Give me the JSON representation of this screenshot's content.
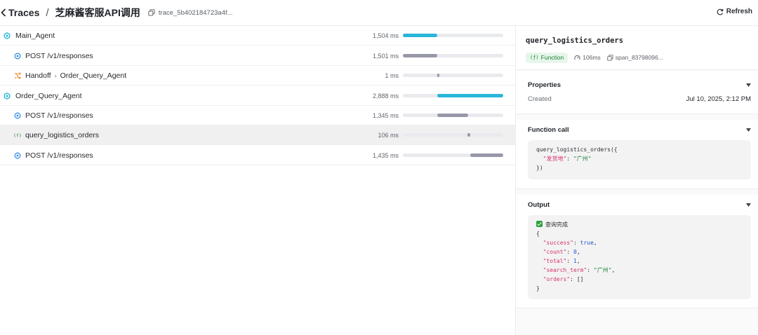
{
  "header": {
    "breadcrumb_root": "Traces",
    "separator": "/",
    "trace_title": "芝麻酱客服API调用",
    "trace_id": "trace_5b402184723a4f...",
    "refresh_label": "Refresh"
  },
  "colors": {
    "agent_bar": "#29b6d9",
    "span_bar": "#9698a8",
    "function_green": "#1a7f37",
    "handoff_orange": "#f08c2c"
  },
  "tree": {
    "rows": [
      {
        "label": "Main_Agent",
        "duration": "1,504 ms",
        "icon": "agent-icon",
        "bar_start": 0.0,
        "bar_fraction": 0.34
      },
      {
        "label": "POST /v1/responses",
        "duration": "1,501 ms",
        "icon": "response-icon",
        "bar_start": 0.0,
        "bar_fraction": 0.34
      },
      {
        "label": "Handoff",
        "target": "Order_Query_Agent",
        "duration": "1 ms",
        "icon": "handoff-icon",
        "bar_start": 0.34,
        "bar_fraction": 0.02
      },
      {
        "label": "Order_Query_Agent",
        "duration": "2,888 ms",
        "icon": "agent-icon",
        "bar_start": 0.345,
        "bar_fraction": 0.655
      },
      {
        "label": "POST /v1/responses",
        "duration": "1,345 ms",
        "icon": "response-icon",
        "bar_start": 0.345,
        "bar_fraction": 0.305
      },
      {
        "label": "query_logistics_orders",
        "duration": "106 ms",
        "icon": "function-icon",
        "bar_start": 0.645,
        "bar_fraction": 0.025
      },
      {
        "label": "POST /v1/responses",
        "duration": "1,435 ms",
        "icon": "response-icon",
        "bar_start": 0.67,
        "bar_fraction": 0.33
      }
    ]
  },
  "details": {
    "title": "query_logistics_orders",
    "badge": "Function",
    "badge_prefix": "(ƒ)",
    "duration": "106ms",
    "span_id": "span_83798096...",
    "properties": {
      "heading": "Properties",
      "created_label": "Created",
      "created_value": "Jul 10, 2025, 2:12 PM"
    },
    "function_call": {
      "heading": "Function call",
      "name": "query_logistics_orders({",
      "arg_key": "\"发货地\"",
      "arg_colon": ": ",
      "arg_value": "\"广州\"",
      "close": "})"
    },
    "output": {
      "heading": "Output",
      "status": "查询完成",
      "open": "{",
      "fields": [
        {
          "key": "\"success\"",
          "value": "true",
          "kind": "n"
        },
        {
          "key": "\"count\"",
          "value": "0",
          "kind": "n"
        },
        {
          "key": "\"total\"",
          "value": "1",
          "kind": "n"
        },
        {
          "key": "\"search_term\"",
          "value": "\"广州\"",
          "kind": "s"
        },
        {
          "key": "\"orders\"",
          "value": "[]",
          "kind": "p"
        }
      ],
      "close": "}"
    }
  }
}
